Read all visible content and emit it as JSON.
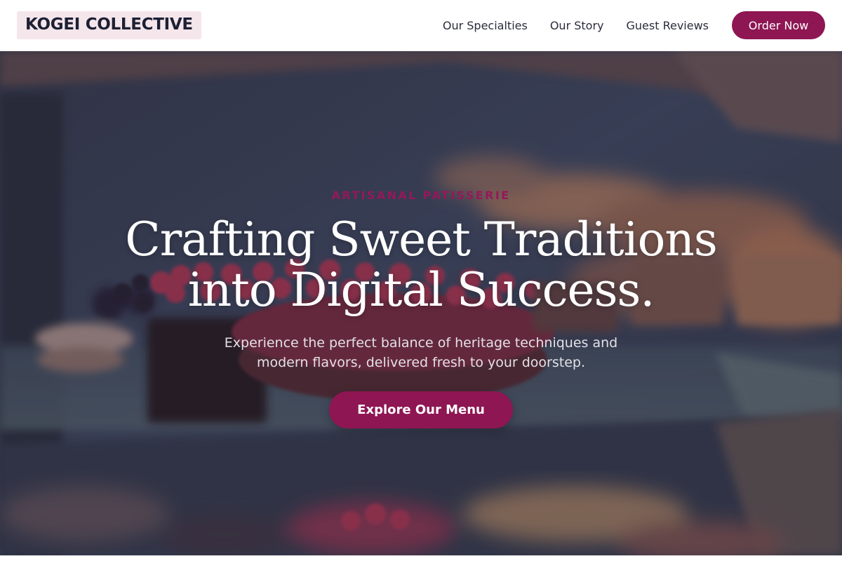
{
  "header": {
    "logo": "KOGEI COLLECTIVE",
    "nav": [
      {
        "label": "Our Specialties"
      },
      {
        "label": "Our Story"
      },
      {
        "label": "Guest Reviews"
      }
    ],
    "order_button": "Order Now"
  },
  "hero": {
    "eyebrow": "ARTISANAL PATISSERIE",
    "headline_line1": "Crafting Sweet Traditions",
    "headline_line2": "into Digital Success.",
    "subtext": "Experience the perfect balance of heritage techniques and modern flavors, delivered fresh to your doorstep.",
    "cta_button": "Explore Our Menu",
    "background_image": "blurred-pastry-display-case"
  },
  "colors": {
    "accent": "#8e1653",
    "logo_bg": "#f5e6ec",
    "logo_text": "#1d2033",
    "nav_text": "#2a2c3c",
    "eyebrow": "#94195a"
  }
}
